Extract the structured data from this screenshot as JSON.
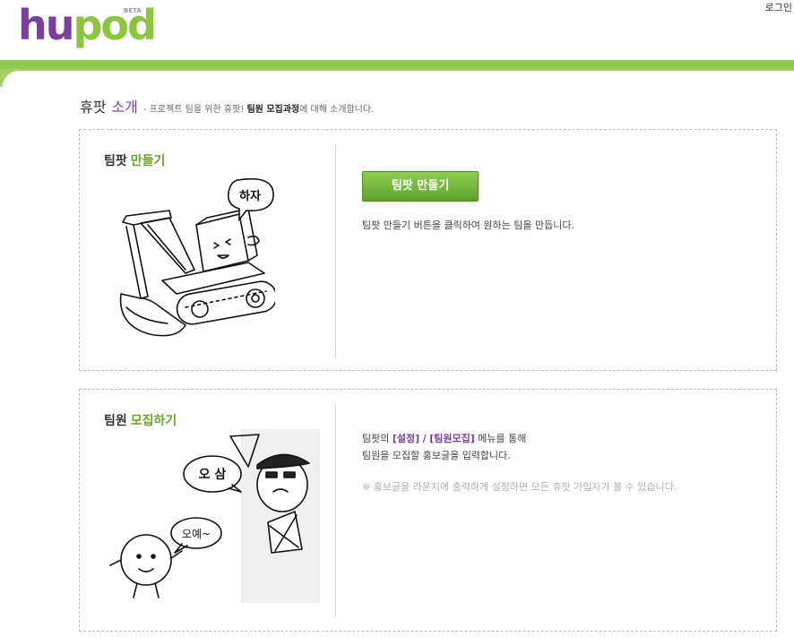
{
  "header": {
    "logo_text_hu": "hu",
    "logo_text_pod": "pod",
    "logo_badge": "BETA",
    "login_label": "로그인",
    "colors": {
      "purple": "#7b3fa0",
      "green": "#8cc63e"
    }
  },
  "intro": {
    "title_part1": "휴팟",
    "title_part2": "소개",
    "subtitle_prefix": "- 프로젝트 팀을 위한 휴팟!",
    "subtitle_bold": "팀원 모집과정",
    "subtitle_suffix": "에 대해 소개합니다."
  },
  "section_create": {
    "title_part1": "팀팟",
    "title_part2": "만들기",
    "button_label": "팀팟 만들기",
    "description": "팀팟 만들기 버튼을 클릭하여 원하는 팀을 만듭니다.",
    "speech_bubble": "하자"
  },
  "section_recruit": {
    "title_part1": "팀원",
    "title_part2": "모집하기",
    "desc_line1_prefix": "팀팟의",
    "desc_line1_hl1": "[설정]",
    "desc_line1_sep": "/",
    "desc_line1_hl2": "[팀원모집]",
    "desc_line1_suffix": "메뉴를 통해",
    "desc_line2": "팀원을 모집할 홍보글을 입력합니다.",
    "note": "※ 홍보글을 라운지에 출력하게 설정하면 모든 휴팟 가입자가 볼 수 있습니다.",
    "speech_bubble1": "오 삼",
    "speech_bubble2": "오예~"
  }
}
